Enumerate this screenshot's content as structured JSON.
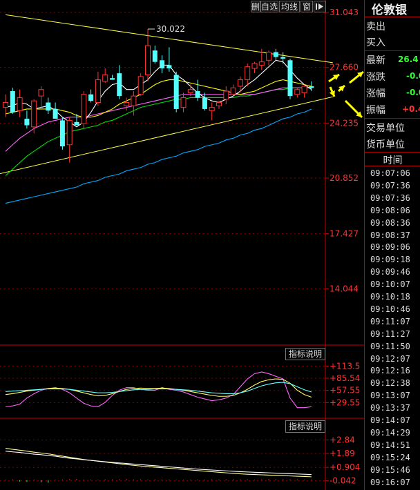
{
  "toolbar": {
    "delete_label": "删",
    "self_select_label": "自选",
    "avg_label": "均线",
    "window_label": "窗"
  },
  "stock": {
    "name": "伦敦银",
    "rows": [
      {
        "label": "卖出",
        "value": ""
      },
      {
        "label": "买入",
        "value": ""
      },
      {
        "label": "最新",
        "value": "26.4",
        "color": "#33ff33"
      },
      {
        "label": "涨跌",
        "value": "-0.0",
        "color": "#33ff33"
      },
      {
        "label": "涨幅",
        "value": "-0.0",
        "color": "#33ff33"
      },
      {
        "label": "振幅",
        "value": "+0.4",
        "color": "#ff3333"
      },
      {
        "label": "交易单位",
        "value": ""
      },
      {
        "label": "货币单位",
        "value": ""
      }
    ]
  },
  "time_header": "时间",
  "times": [
    "09:07:06",
    "09:07:36",
    "09:07:36",
    "09:08:06",
    "09:08:36",
    "09:08:37",
    "09:09:06",
    "09:09:18",
    "09:09:46",
    "09:10:07",
    "09:10:18",
    "09:10:46",
    "09:11:07",
    "09:11:27",
    "09:11:50",
    "09:12:07",
    "09:12:16",
    "09:12:38",
    "09:13:07",
    "09:13:37",
    "09:14:07",
    "09:14:29",
    "09:14:51",
    "09:15:24",
    "09:15:46",
    "09:16:07"
  ],
  "indicator_label_1": "指标说明",
  "indicator_label_2": "指标说明",
  "colors": {
    "up": "#ff3232",
    "down": "#54ffff",
    "ma5": "#ffffff",
    "ma10": "#ffff00",
    "ma20": "#ff66ff",
    "ma30": "#00dd00",
    "ma60": "#00aaff",
    "trend": "#ffff44",
    "arrow": "#ffff00"
  },
  "chart_data": [
    {
      "type": "candlestick",
      "ylim": [
        10.66,
        31.043
      ],
      "y_ticks": [
        "31.043",
        "27.660",
        "24.235",
        "20.852",
        "17.427",
        "14.044"
      ],
      "y_tick_values": [
        31.043,
        27.66,
        24.235,
        20.852,
        17.427,
        14.044
      ],
      "peak_annotation": "30.022",
      "peak_value": 30.022,
      "candles": [
        {
          "o": 25.2,
          "h": 26.0,
          "l": 24.6,
          "c": 25.5
        },
        {
          "o": 26.2,
          "h": 26.4,
          "l": 24.8,
          "c": 24.9
        },
        {
          "o": 25.0,
          "h": 26.3,
          "l": 24.6,
          "c": 25.8
        },
        {
          "o": 24.5,
          "h": 25.0,
          "l": 23.9,
          "c": 24.1
        },
        {
          "o": 24.0,
          "h": 25.7,
          "l": 23.6,
          "c": 25.6
        },
        {
          "o": 25.9,
          "h": 26.5,
          "l": 25.2,
          "c": 26.3
        },
        {
          "o": 25.5,
          "h": 25.8,
          "l": 24.8,
          "c": 25.0
        },
        {
          "o": 25.1,
          "h": 25.5,
          "l": 24.5,
          "c": 24.5
        },
        {
          "o": 24.4,
          "h": 24.6,
          "l": 22.6,
          "c": 22.8
        },
        {
          "o": 22.9,
          "h": 24.6,
          "l": 21.8,
          "c": 24.4
        },
        {
          "o": 24.3,
          "h": 24.8,
          "l": 24.1,
          "c": 24.1
        },
        {
          "o": 24.2,
          "h": 26.2,
          "l": 23.9,
          "c": 26.0
        },
        {
          "o": 26.0,
          "h": 26.3,
          "l": 25.5,
          "c": 25.6
        },
        {
          "o": 25.5,
          "h": 27.4,
          "l": 25.3,
          "c": 26.9
        },
        {
          "o": 26.8,
          "h": 27.6,
          "l": 26.7,
          "c": 27.2
        },
        {
          "o": 27.0,
          "h": 27.2,
          "l": 26.9,
          "c": 26.9
        },
        {
          "o": 27.3,
          "h": 27.8,
          "l": 25.7,
          "c": 25.9
        },
        {
          "o": 25.3,
          "h": 25.8,
          "l": 25.0,
          "c": 25.5
        },
        {
          "o": 25.3,
          "h": 26.2,
          "l": 24.7,
          "c": 25.9
        },
        {
          "o": 26.0,
          "h": 27.3,
          "l": 25.9,
          "c": 27.1
        },
        {
          "o": 27.2,
          "h": 30.022,
          "l": 26.8,
          "c": 29.0
        },
        {
          "o": 28.7,
          "h": 29.0,
          "l": 27.9,
          "c": 28.0
        },
        {
          "o": 28.1,
          "h": 28.4,
          "l": 27.3,
          "c": 27.6
        },
        {
          "o": 27.8,
          "h": 28.9,
          "l": 27.4,
          "c": 27.6
        },
        {
          "o": 27.2,
          "h": 27.4,
          "l": 24.9,
          "c": 25.1
        },
        {
          "o": 25.2,
          "h": 26.1,
          "l": 24.9,
          "c": 25.8
        },
        {
          "o": 26.1,
          "h": 26.6,
          "l": 25.9,
          "c": 26.3
        },
        {
          "o": 26.2,
          "h": 26.9,
          "l": 25.6,
          "c": 25.8
        },
        {
          "o": 25.8,
          "h": 26.1,
          "l": 25.0,
          "c": 25.1
        },
        {
          "o": 25.0,
          "h": 25.5,
          "l": 24.4,
          "c": 25.2
        },
        {
          "o": 25.3,
          "h": 25.6,
          "l": 25.1,
          "c": 25.5
        },
        {
          "o": 25.7,
          "h": 26.5,
          "l": 25.4,
          "c": 26.2
        },
        {
          "o": 26.0,
          "h": 26.6,
          "l": 25.9,
          "c": 26.4
        },
        {
          "o": 26.5,
          "h": 27.1,
          "l": 26.1,
          "c": 26.9
        },
        {
          "o": 26.9,
          "h": 27.9,
          "l": 26.5,
          "c": 27.7
        },
        {
          "o": 27.6,
          "h": 28.0,
          "l": 27.3,
          "c": 27.9
        },
        {
          "o": 27.8,
          "h": 28.8,
          "l": 27.5,
          "c": 28.0
        },
        {
          "o": 28.1,
          "h": 28.7,
          "l": 27.8,
          "c": 28.6
        },
        {
          "o": 28.6,
          "h": 28.8,
          "l": 28.1,
          "c": 28.3
        },
        {
          "o": 28.3,
          "h": 28.6,
          "l": 27.9,
          "c": 28.2
        },
        {
          "o": 28.1,
          "h": 28.2,
          "l": 25.7,
          "c": 25.9
        },
        {
          "o": 26.0,
          "h": 26.4,
          "l": 25.8,
          "c": 26.3
        },
        {
          "o": 26.1,
          "h": 26.6,
          "l": 25.8,
          "c": 26.5
        },
        {
          "o": 26.5,
          "h": 26.8,
          "l": 26.2,
          "c": 26.4
        }
      ],
      "ma5": [
        25.2,
        25.3,
        25.5,
        25.4,
        25.1,
        25.2,
        25.3,
        25.0,
        24.6,
        24.3,
        24.0,
        24.3,
        24.9,
        25.6,
        26.2,
        26.6,
        26.7,
        26.3,
        26.3,
        26.6,
        26.9,
        27.4,
        27.8,
        27.8,
        27.2,
        26.9,
        26.5,
        26.1,
        25.8,
        25.6,
        25.5,
        25.7,
        25.9,
        26.2,
        26.6,
        26.9,
        27.3,
        27.7,
        28.1,
        28.0,
        27.5,
        27.0,
        26.6,
        26.3
      ],
      "ma10": [
        24.8,
        24.9,
        25.0,
        25.1,
        25.1,
        25.1,
        25.1,
        25.1,
        25.0,
        24.9,
        24.7,
        24.6,
        24.6,
        24.7,
        24.9,
        25.1,
        25.4,
        25.6,
        25.8,
        26.0,
        26.3,
        26.6,
        26.8,
        26.9,
        26.9,
        26.8,
        26.7,
        26.6,
        26.5,
        26.4,
        26.3,
        26.2,
        26.1,
        26.0,
        26.1,
        26.2,
        26.4,
        26.6,
        26.8,
        26.9,
        26.8,
        26.7,
        26.6,
        26.5
      ],
      "ma20": [
        22.5,
        22.9,
        23.3,
        23.6,
        23.9,
        24.1,
        24.3,
        24.4,
        24.5,
        24.6,
        24.6,
        24.6,
        24.7,
        24.8,
        24.9,
        25.0,
        25.1,
        25.2,
        25.3,
        25.4,
        25.5,
        25.6,
        25.7,
        25.8,
        25.9,
        26.0,
        26.0,
        26.0,
        26.0,
        26.0,
        26.0,
        26.0,
        26.0,
        26.0,
        26.0,
        26.0,
        26.1,
        26.2,
        26.3,
        26.4,
        26.4,
        26.4,
        26.4,
        26.4
      ],
      "ma30": [
        21.0,
        21.4,
        21.8,
        22.2,
        22.5,
        22.8,
        23.1,
        23.3,
        23.5,
        23.7,
        23.8,
        23.9,
        24.0,
        24.1,
        24.3,
        24.4,
        24.6,
        24.8,
        25.0,
        25.2,
        25.3,
        25.4,
        25.5,
        25.6,
        25.7,
        25.7,
        25.8,
        25.8,
        25.8,
        25.8,
        25.8,
        25.8,
        25.8,
        25.9,
        25.9,
        26.0,
        26.1,
        26.2,
        26.3,
        26.3,
        26.4,
        26.4,
        26.4,
        26.4
      ],
      "ma60": [
        19.3,
        19.4,
        19.5,
        19.6,
        19.7,
        19.8,
        19.9,
        20.0,
        20.1,
        20.2,
        20.3,
        20.5,
        20.6,
        20.7,
        20.9,
        21.0,
        21.1,
        21.3,
        21.4,
        21.5,
        21.7,
        21.8,
        22.0,
        22.1,
        22.2,
        22.4,
        22.5,
        22.6,
        22.8,
        22.9,
        23.0,
        23.2,
        23.3,
        23.5,
        23.6,
        23.8,
        23.9,
        24.1,
        24.3,
        24.5,
        24.6,
        24.8,
        24.9,
        25.1
      ],
      "trendlines": [
        {
          "from": [
            0,
            30.9
          ],
          "to": [
            46,
            27.95
          ]
        },
        {
          "from": [
            -2,
            21.0
          ],
          "to": [
            46,
            25.85
          ]
        }
      ]
    },
    {
      "type": "line",
      "ylim": [
        0,
        130
      ],
      "y_ticks": [
        "+113.5",
        "+85.54",
        "+57.55",
        "+29.55"
      ],
      "y_tick_values": [
        113.5,
        85.54,
        57.55,
        29.55
      ],
      "series": [
        {
          "color": "#ff66ff",
          "values": [
            20,
            22,
            26,
            40,
            50,
            58,
            62,
            64,
            60,
            52,
            40,
            28,
            22,
            20,
            30,
            46,
            58,
            64,
            64,
            60,
            58,
            58,
            64,
            60,
            58,
            54,
            48,
            42,
            38,
            34,
            36,
            40,
            48,
            66,
            84,
            96,
            100,
            96,
            90,
            84,
            40,
            18,
            18,
            20
          ]
        },
        {
          "color": "#ffff66",
          "values": [
            48,
            50,
            53,
            56,
            58,
            60,
            62,
            63,
            62,
            60,
            56,
            52,
            48,
            45,
            46,
            50,
            55,
            60,
            62,
            63,
            62,
            62,
            63,
            62,
            60,
            58,
            55,
            52,
            49,
            46,
            44,
            44,
            46,
            52,
            60,
            70,
            78,
            82,
            84,
            83,
            74,
            58,
            48,
            42
          ]
        },
        {
          "color": "#66ffff",
          "values": [
            55,
            56,
            57,
            58,
            59,
            60,
            61,
            61,
            61,
            60,
            58,
            56,
            54,
            52,
            52,
            53,
            55,
            57,
            59,
            60,
            60,
            61,
            61,
            61,
            60,
            59,
            58,
            56,
            54,
            52,
            51,
            50,
            50,
            52,
            56,
            62,
            68,
            72,
            75,
            76,
            73,
            66,
            59,
            54
          ]
        }
      ]
    },
    {
      "type": "line",
      "ylim": [
        -0.4,
        3.4
      ],
      "y_ticks": [
        "+2.84",
        "+1.89",
        "+0.904",
        "-0.042"
      ],
      "y_tick_values": [
        2.84,
        1.89,
        0.904,
        -0.042
      ],
      "series": [
        {
          "color": "#ffff99",
          "values": [
            2.25,
            2.18,
            2.12,
            2.05,
            1.98,
            1.92,
            1.86,
            1.78,
            1.7,
            1.62,
            1.54,
            1.46,
            1.4,
            1.34,
            1.28,
            1.22,
            1.16,
            1.1,
            1.05,
            1.0,
            0.96,
            0.92,
            0.88,
            0.84,
            0.8,
            0.76,
            0.72,
            0.68,
            0.64,
            0.6,
            0.56,
            0.52,
            0.48,
            0.45,
            0.42,
            0.4,
            0.38,
            0.36,
            0.34,
            0.32,
            0.3,
            0.28,
            0.26,
            0.24
          ]
        },
        {
          "color": "#ffffff",
          "values": [
            2.05,
            2.0,
            1.96,
            1.9,
            1.84,
            1.8,
            1.74,
            1.7,
            1.62,
            1.55,
            1.5,
            1.44,
            1.4,
            1.35,
            1.3,
            1.26,
            1.22,
            1.18,
            1.14,
            1.1,
            1.06,
            1.02,
            0.98,
            0.94,
            0.9,
            0.86,
            0.82,
            0.78,
            0.75,
            0.72,
            0.69,
            0.66,
            0.63,
            0.6,
            0.58,
            0.56,
            0.54,
            0.52,
            0.5,
            0.48,
            0.46,
            0.44,
            0.42,
            0.4
          ]
        }
      ],
      "histogram": [
        0.03,
        0.05,
        -0.1,
        -0.12,
        0.04,
        -0.15,
        -0.18,
        0.03,
        0.04,
        0.06,
        0.08,
        0.04,
        0.04,
        0.03,
        0.05,
        0.05,
        0.06,
        0.07,
        0.04,
        0.05,
        0.04,
        0.05,
        0.04,
        0.04,
        0.03,
        0.03,
        0.04,
        0.04,
        0.04,
        0.05,
        0.04,
        0.05,
        0.06,
        0.05,
        0.05,
        0.04,
        0.05,
        0.07,
        0.06,
        0.06,
        0.05,
        0.05,
        0.04,
        0.05
      ]
    }
  ]
}
